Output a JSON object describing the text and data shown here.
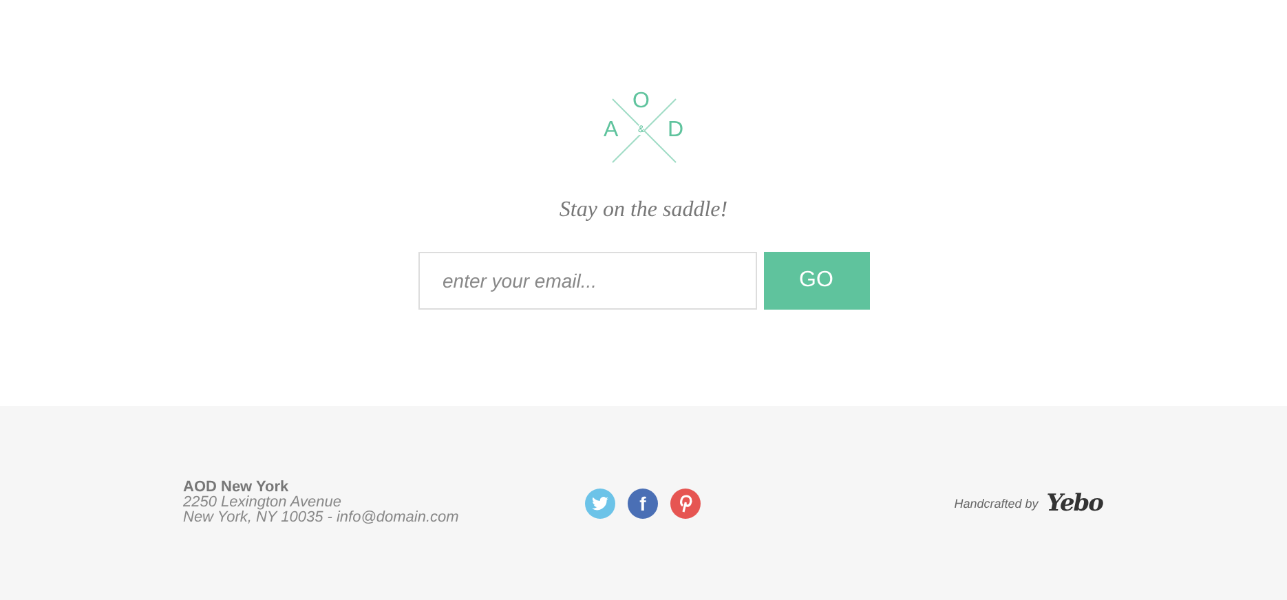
{
  "logo": {
    "letters": [
      "A",
      "O",
      "&",
      "D"
    ]
  },
  "tagline": "Stay on the saddle!",
  "signup": {
    "placeholder": "enter your email...",
    "button": "GO"
  },
  "footer": {
    "address": {
      "name": "AOD New York",
      "street": "2250 Lexington Avenue",
      "city": "New York, NY 10035 - info@domain.com"
    },
    "social": [
      {
        "kind": "bird",
        "color": "#6cc3e8"
      },
      {
        "kind": "letter",
        "text": "f",
        "color": "#4a6fb5"
      },
      {
        "kind": "pin",
        "color": "#e65552"
      }
    ],
    "credit": {
      "text": "Handcrafted by",
      "brand": "Yebo"
    }
  }
}
